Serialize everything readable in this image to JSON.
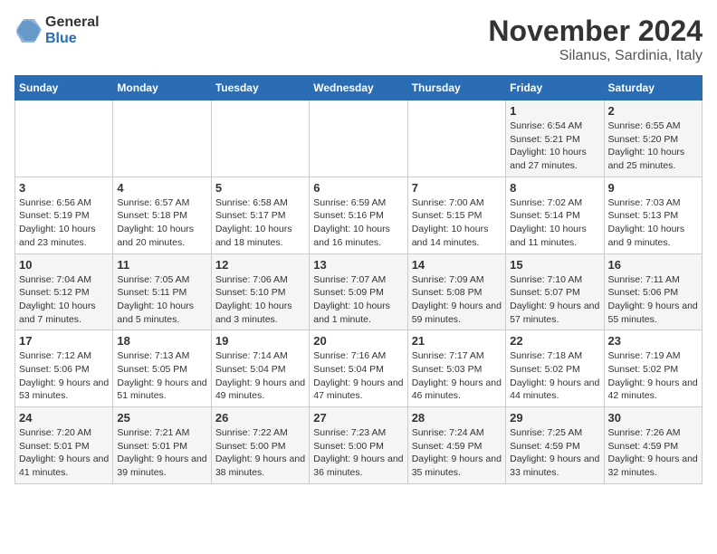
{
  "logo": {
    "general": "General",
    "blue": "Blue"
  },
  "title": "November 2024",
  "location": "Silanus, Sardinia, Italy",
  "weekdays": [
    "Sunday",
    "Monday",
    "Tuesday",
    "Wednesday",
    "Thursday",
    "Friday",
    "Saturday"
  ],
  "weeks": [
    [
      {
        "day": "",
        "info": ""
      },
      {
        "day": "",
        "info": ""
      },
      {
        "day": "",
        "info": ""
      },
      {
        "day": "",
        "info": ""
      },
      {
        "day": "",
        "info": ""
      },
      {
        "day": "1",
        "info": "Sunrise: 6:54 AM\nSunset: 5:21 PM\nDaylight: 10 hours and 27 minutes."
      },
      {
        "day": "2",
        "info": "Sunrise: 6:55 AM\nSunset: 5:20 PM\nDaylight: 10 hours and 25 minutes."
      }
    ],
    [
      {
        "day": "3",
        "info": "Sunrise: 6:56 AM\nSunset: 5:19 PM\nDaylight: 10 hours and 23 minutes."
      },
      {
        "day": "4",
        "info": "Sunrise: 6:57 AM\nSunset: 5:18 PM\nDaylight: 10 hours and 20 minutes."
      },
      {
        "day": "5",
        "info": "Sunrise: 6:58 AM\nSunset: 5:17 PM\nDaylight: 10 hours and 18 minutes."
      },
      {
        "day": "6",
        "info": "Sunrise: 6:59 AM\nSunset: 5:16 PM\nDaylight: 10 hours and 16 minutes."
      },
      {
        "day": "7",
        "info": "Sunrise: 7:00 AM\nSunset: 5:15 PM\nDaylight: 10 hours and 14 minutes."
      },
      {
        "day": "8",
        "info": "Sunrise: 7:02 AM\nSunset: 5:14 PM\nDaylight: 10 hours and 11 minutes."
      },
      {
        "day": "9",
        "info": "Sunrise: 7:03 AM\nSunset: 5:13 PM\nDaylight: 10 hours and 9 minutes."
      }
    ],
    [
      {
        "day": "10",
        "info": "Sunrise: 7:04 AM\nSunset: 5:12 PM\nDaylight: 10 hours and 7 minutes."
      },
      {
        "day": "11",
        "info": "Sunrise: 7:05 AM\nSunset: 5:11 PM\nDaylight: 10 hours and 5 minutes."
      },
      {
        "day": "12",
        "info": "Sunrise: 7:06 AM\nSunset: 5:10 PM\nDaylight: 10 hours and 3 minutes."
      },
      {
        "day": "13",
        "info": "Sunrise: 7:07 AM\nSunset: 5:09 PM\nDaylight: 10 hours and 1 minute."
      },
      {
        "day": "14",
        "info": "Sunrise: 7:09 AM\nSunset: 5:08 PM\nDaylight: 9 hours and 59 minutes."
      },
      {
        "day": "15",
        "info": "Sunrise: 7:10 AM\nSunset: 5:07 PM\nDaylight: 9 hours and 57 minutes."
      },
      {
        "day": "16",
        "info": "Sunrise: 7:11 AM\nSunset: 5:06 PM\nDaylight: 9 hours and 55 minutes."
      }
    ],
    [
      {
        "day": "17",
        "info": "Sunrise: 7:12 AM\nSunset: 5:06 PM\nDaylight: 9 hours and 53 minutes."
      },
      {
        "day": "18",
        "info": "Sunrise: 7:13 AM\nSunset: 5:05 PM\nDaylight: 9 hours and 51 minutes."
      },
      {
        "day": "19",
        "info": "Sunrise: 7:14 AM\nSunset: 5:04 PM\nDaylight: 9 hours and 49 minutes."
      },
      {
        "day": "20",
        "info": "Sunrise: 7:16 AM\nSunset: 5:04 PM\nDaylight: 9 hours and 47 minutes."
      },
      {
        "day": "21",
        "info": "Sunrise: 7:17 AM\nSunset: 5:03 PM\nDaylight: 9 hours and 46 minutes."
      },
      {
        "day": "22",
        "info": "Sunrise: 7:18 AM\nSunset: 5:02 PM\nDaylight: 9 hours and 44 minutes."
      },
      {
        "day": "23",
        "info": "Sunrise: 7:19 AM\nSunset: 5:02 PM\nDaylight: 9 hours and 42 minutes."
      }
    ],
    [
      {
        "day": "24",
        "info": "Sunrise: 7:20 AM\nSunset: 5:01 PM\nDaylight: 9 hours and 41 minutes."
      },
      {
        "day": "25",
        "info": "Sunrise: 7:21 AM\nSunset: 5:01 PM\nDaylight: 9 hours and 39 minutes."
      },
      {
        "day": "26",
        "info": "Sunrise: 7:22 AM\nSunset: 5:00 PM\nDaylight: 9 hours and 38 minutes."
      },
      {
        "day": "27",
        "info": "Sunrise: 7:23 AM\nSunset: 5:00 PM\nDaylight: 9 hours and 36 minutes."
      },
      {
        "day": "28",
        "info": "Sunrise: 7:24 AM\nSunset: 4:59 PM\nDaylight: 9 hours and 35 minutes."
      },
      {
        "day": "29",
        "info": "Sunrise: 7:25 AM\nSunset: 4:59 PM\nDaylight: 9 hours and 33 minutes."
      },
      {
        "day": "30",
        "info": "Sunrise: 7:26 AM\nSunset: 4:59 PM\nDaylight: 9 hours and 32 minutes."
      }
    ]
  ]
}
